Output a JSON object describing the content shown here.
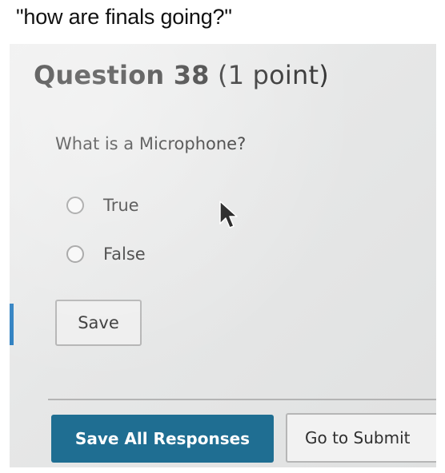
{
  "caption": "\"how are finals going?\"",
  "quiz": {
    "question_number": "Question 38",
    "points": "(1 point)",
    "prompt": "What is a Microphone?",
    "options": [
      {
        "label": "True",
        "selected": false
      },
      {
        "label": "False",
        "selected": false
      }
    ],
    "save_label": "Save"
  },
  "footer": {
    "save_all_label": "Save All Responses",
    "submit_label": "Go to Submit"
  },
  "colors": {
    "accent": "#2b7ec0",
    "primary_button": "#1f6e92"
  },
  "icons": {
    "cursor": "mouse-pointer-icon",
    "radio": "radio-unchecked-icon"
  }
}
